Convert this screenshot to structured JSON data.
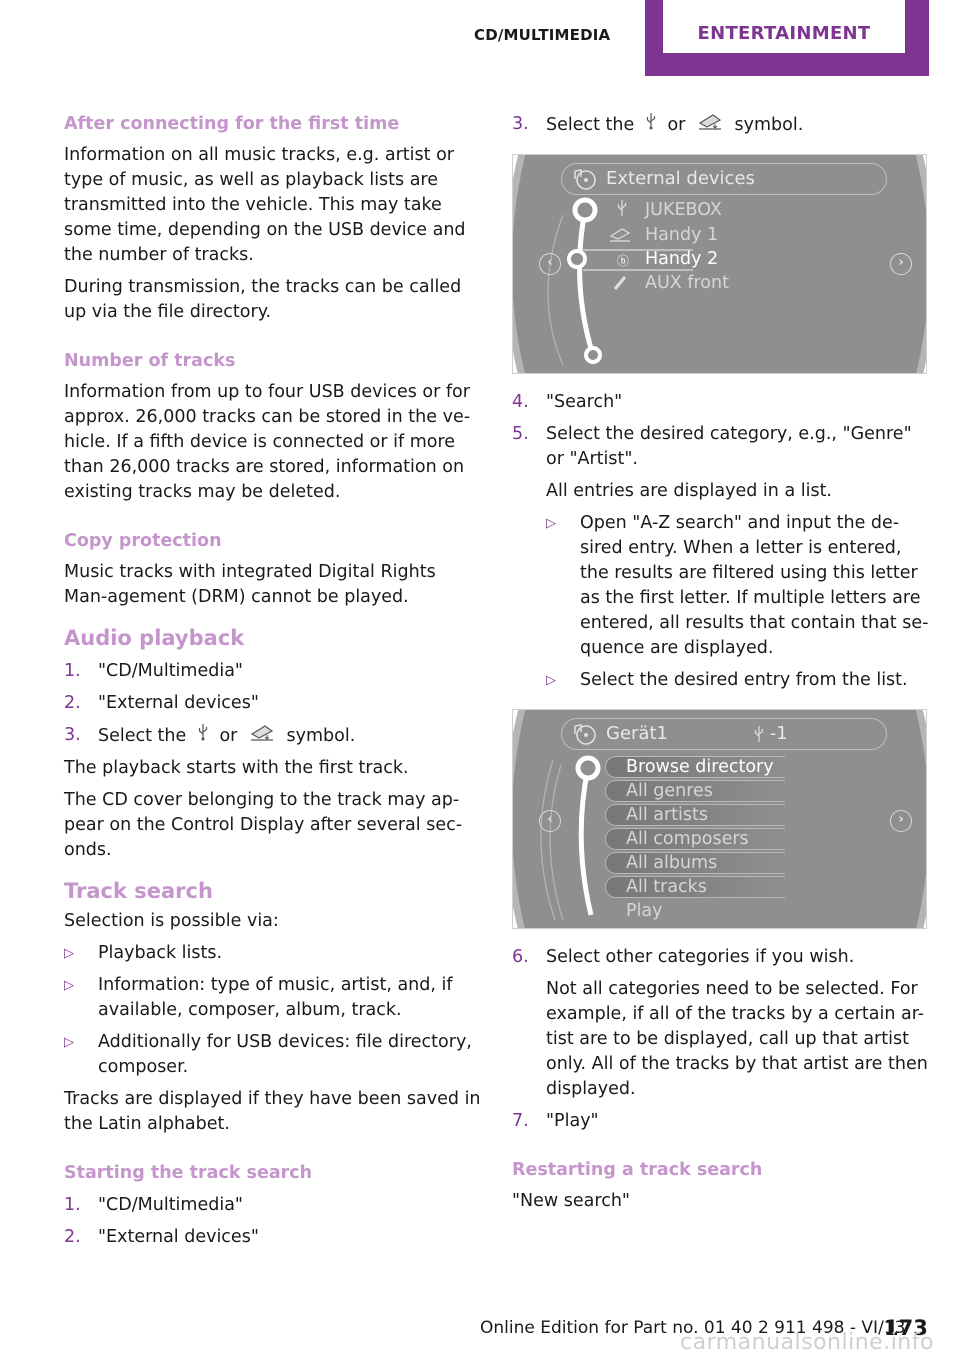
{
  "header": {
    "section": "CD/MULTIMEDIA",
    "chapter": "ENTERTAINMENT"
  },
  "left": {
    "after_connecting": {
      "heading": "After connecting for the first time",
      "p1": "Information on all music tracks, e.g. artist or type of music, as well as playback lists are transmitted into the vehicle. This may take some time, depending on the USB device and the number of tracks.",
      "p2": "During transmission, the tracks can be called up via the file directory."
    },
    "number_of_tracks": {
      "heading": "Number of tracks",
      "p1": "Information from up to four USB devices or for approx. 26,000 tracks can be stored in the ve-hicle. If a fifth device is connected or if more than 26,000 tracks are stored, information on existing tracks may be deleted."
    },
    "copy_protection": {
      "heading": "Copy protection",
      "p1": "Music tracks with integrated Digital Rights Man-agement (DRM) cannot be played."
    },
    "audio_playback": {
      "heading": "Audio playback",
      "steps": [
        {
          "num": "1.",
          "text": "\"CD/Multimedia\""
        },
        {
          "num": "2.",
          "text": "\"External devices\""
        },
        {
          "num": "3.",
          "pre": "Select the",
          "mid": "or",
          "post": "symbol."
        }
      ],
      "p1": "The playback starts with the first track.",
      "p2": "The CD cover belonging to the track may ap-pear on the Control Display after several sec-onds."
    },
    "track_search": {
      "heading": "Track search",
      "intro": "Selection is possible via:",
      "bullets": [
        "Playback lists.",
        "Information: type of music, artist, and, if available, composer, album, track.",
        "Additionally for USB devices: file directory, composer."
      ],
      "note": "Tracks are displayed if they have been saved in the Latin alphabet."
    },
    "starting_search": {
      "heading": "Starting the track search",
      "steps": [
        {
          "num": "1.",
          "text": "\"CD/Multimedia\""
        },
        {
          "num": "2.",
          "text": "\"External devices\""
        }
      ]
    }
  },
  "right": {
    "step3": {
      "num": "3.",
      "pre": "Select the",
      "mid": "or",
      "post": "symbol."
    },
    "screen1": {
      "title": "External devices",
      "items": [
        {
          "icon": "usb-icon",
          "label": "JUKEBOX"
        },
        {
          "icon": "phone-cradle-icon",
          "label": "Handy 1"
        },
        {
          "icon": "bluetooth-icon",
          "label": "Handy 2",
          "selected": true
        },
        {
          "icon": "aux-plug-icon",
          "label": "AUX front"
        }
      ]
    },
    "steps_after": [
      {
        "num": "4.",
        "text": "\"Search\""
      },
      {
        "num": "5.",
        "text": "Select the desired category, e.g., \"Genre\" or \"Artist\"."
      }
    ],
    "step5_note": "All entries are displayed in a list.",
    "step5_bullets": [
      "Open \"A-Z search\" and input the de-sired entry. When a letter is entered, the results are filtered using this letter as the first letter. If multiple letters are entered, all results that contain that se-quence are displayed.",
      "Select the desired entry from the list."
    ],
    "screen2": {
      "title": "Gerät1",
      "usb_count": "-1",
      "items": [
        {
          "label": "Browse directory",
          "selected": true
        },
        {
          "label": "All genres"
        },
        {
          "label": "All artists"
        },
        {
          "label": "All composers"
        },
        {
          "label": "All albums"
        },
        {
          "label": "All tracks"
        },
        {
          "label": "Play"
        }
      ]
    },
    "steps_final": [
      {
        "num": "6.",
        "text": "Select other categories if you wish."
      },
      {
        "num": "7.",
        "text": "\"Play\""
      }
    ],
    "step6_note": "Not all categories need to be selected. For example, if all of the tracks by a certain ar-tist are to be displayed, call up that artist only. All of the tracks by that artist are then displayed.",
    "restart": {
      "heading": "Restarting a track search",
      "text": "\"New search\""
    }
  },
  "footer": {
    "edition": "Online Edition for Part no. 01 40 2 911 498 - VI/13",
    "page": "173",
    "watermark": "carmanualsonline.info"
  },
  "colors": {
    "accent": "#7e3591",
    "heading": "#c596cc",
    "screen_bg": "#8f8f8f"
  }
}
